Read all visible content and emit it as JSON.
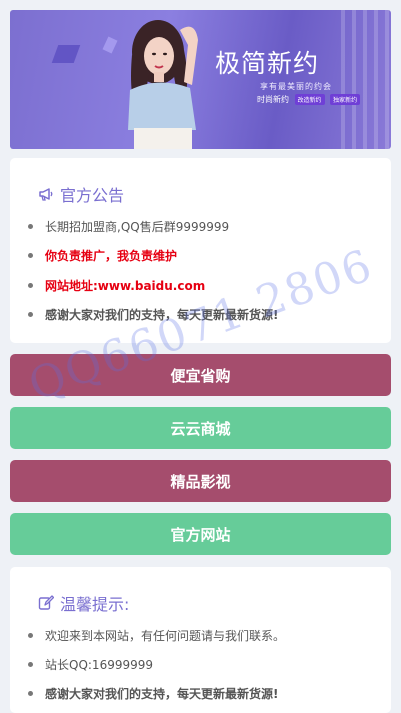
{
  "banner": {
    "title": "极简新约",
    "subtitle": "享有最美丽的约会",
    "tagline": "时尚新约",
    "tags": [
      "改造新约",
      "独家新约"
    ]
  },
  "notice": {
    "heading": "官方公告",
    "items": [
      "长期招加盟商,QQ售后群9999999",
      "你负责推广，我负责维护",
      "网站地址:www.baidu.com",
      "感谢大家对我们的支持，每天更新最新货源!"
    ]
  },
  "buttons": [
    {
      "label": "便宜省购",
      "color": "#a54d6d"
    },
    {
      "label": "云云商城",
      "color": "#66cc99"
    },
    {
      "label": "精品影视",
      "color": "#a54d6d"
    },
    {
      "label": "官方网站",
      "color": "#66cc99"
    }
  ],
  "tips": {
    "heading": "温馨提示:",
    "items": [
      "欢迎来到本网站，有任何问题请与我们联系。",
      "站长QQ:16999999",
      "感谢大家对我们的支持，每天更新最新货源!"
    ]
  },
  "watermark": "QQ66071 2806"
}
